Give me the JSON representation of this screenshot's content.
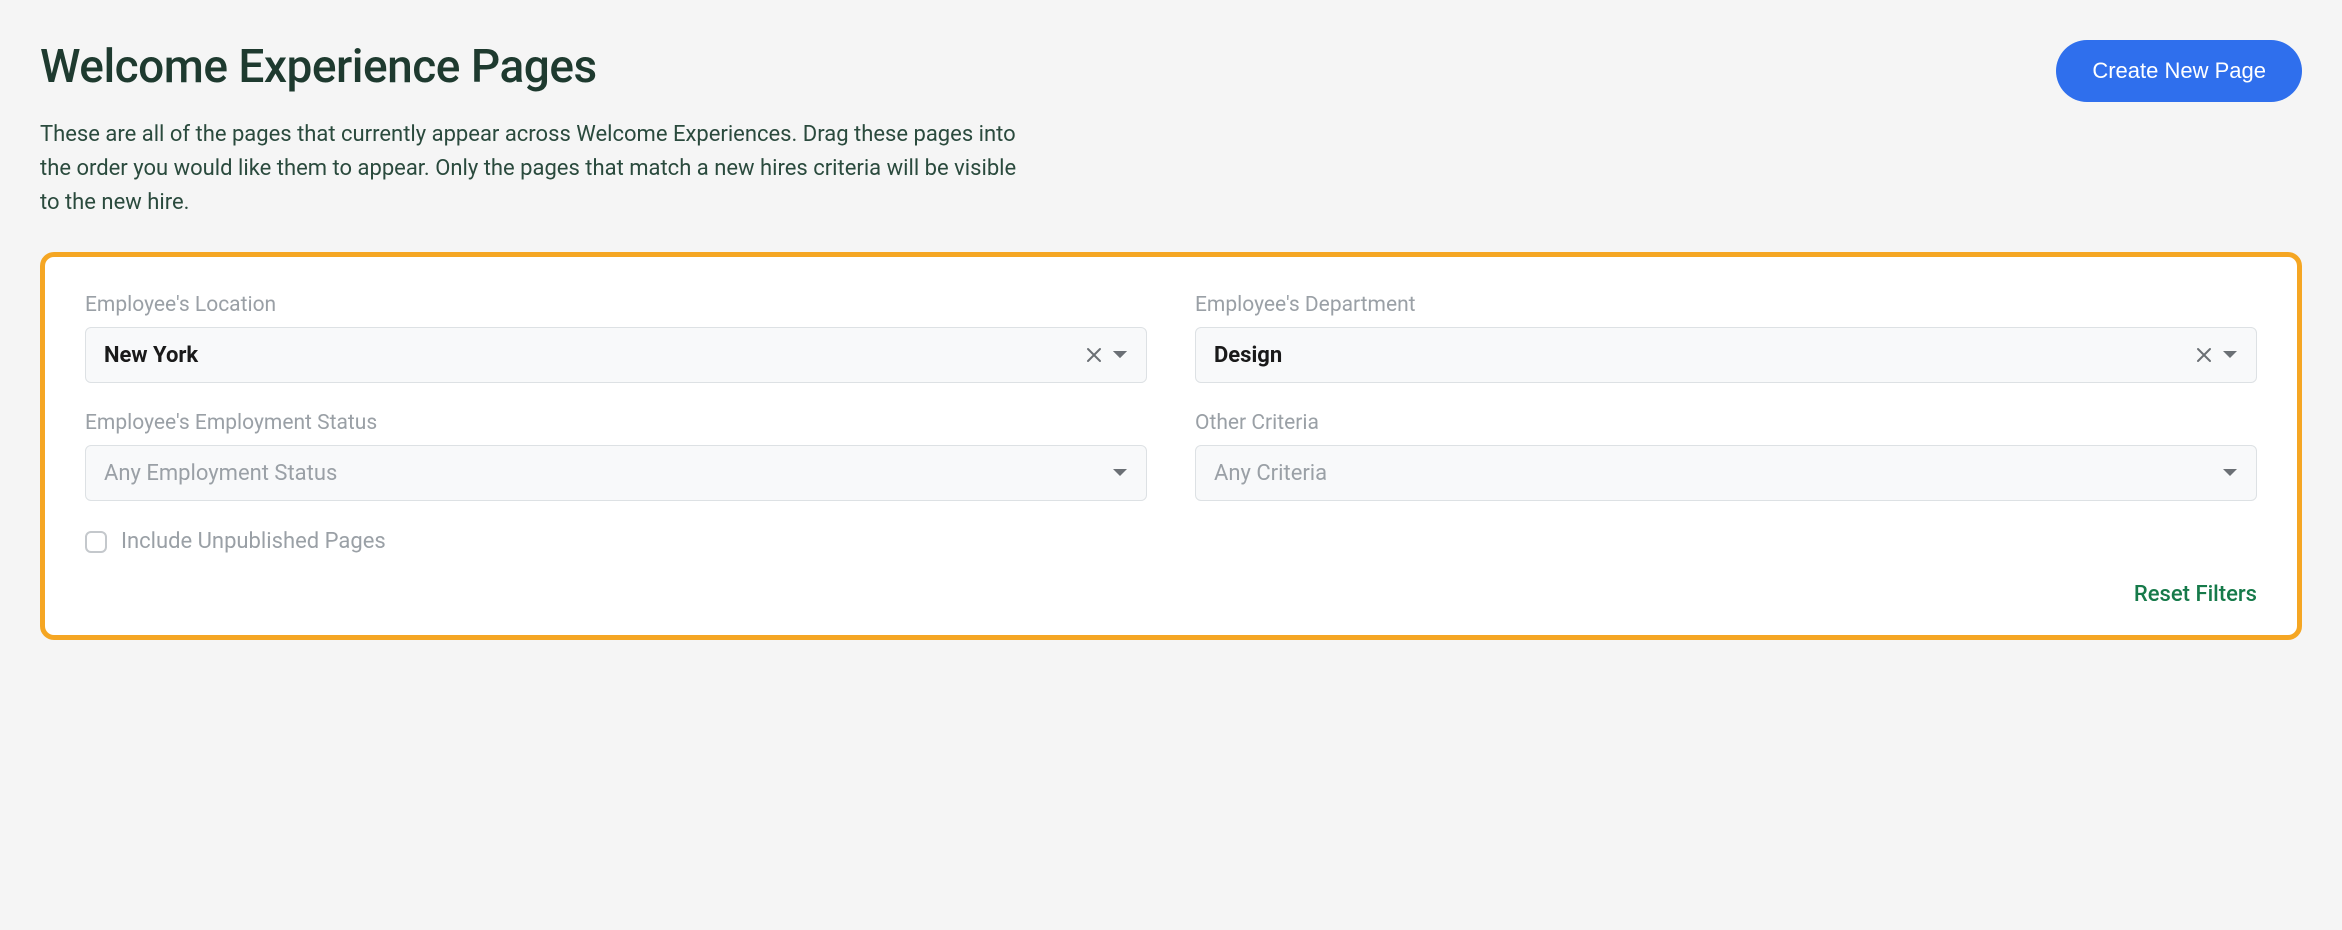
{
  "header": {
    "title": "Welcome Experience Pages",
    "create_button": "Create New Page",
    "description": "These are all of the pages that currently appear across Welcome Experiences. Drag these pages into the order you would like them to appear. Only the pages that match a new hires criteria will be visible to the new hire."
  },
  "filters": {
    "location": {
      "label": "Employee's Location",
      "value": "New York",
      "has_value": true
    },
    "department": {
      "label": "Employee's Department",
      "value": "Design",
      "has_value": true
    },
    "employment_status": {
      "label": "Employee's Employment Status",
      "placeholder": "Any Employment Status",
      "has_value": false
    },
    "other_criteria": {
      "label": "Other Criteria",
      "placeholder": "Any Criteria",
      "has_value": false
    },
    "include_unpublished": {
      "label": "Include Unpublished Pages",
      "checked": false
    },
    "reset_label": "Reset Filters"
  },
  "colors": {
    "accent_blue": "#2f6fed",
    "highlight_orange": "#f5a623",
    "text_dark_green": "#1e3a2f",
    "link_green": "#167a4a"
  }
}
